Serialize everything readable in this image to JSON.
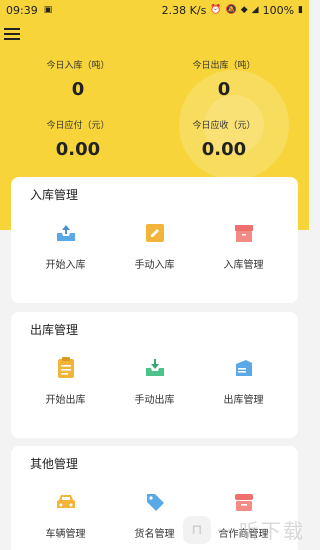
{
  "status_bar": {
    "time": "09:39",
    "speed": "2.38 K/s",
    "battery": "100%"
  },
  "header": {
    "stats": [
      {
        "label": "今日入库（吨）",
        "value": "0"
      },
      {
        "label": "今日出库（吨）",
        "value": "0"
      },
      {
        "label": "今日应付（元）",
        "value": "0.00"
      },
      {
        "label": "今日应收（元）",
        "value": "0.00"
      }
    ]
  },
  "sections": [
    {
      "title": "入库管理",
      "items": [
        {
          "label": "开始入库",
          "icon": "inbox-upload-icon",
          "color": "#5aa9e6"
        },
        {
          "label": "手动入库",
          "icon": "edit-icon",
          "color": "#f2b53a"
        },
        {
          "label": "入库管理",
          "icon": "box-manage-icon",
          "color": "#ef6f6c"
        }
      ]
    },
    {
      "title": "出库管理",
      "items": [
        {
          "label": "开始出库",
          "icon": "clipboard-icon",
          "color": "#f2b53a"
        },
        {
          "label": "手动出库",
          "icon": "download-tray-icon",
          "color": "#4cc38a"
        },
        {
          "label": "出库管理",
          "icon": "shipping-box-icon",
          "color": "#5aa9e6"
        }
      ]
    },
    {
      "title": "其他管理",
      "items": [
        {
          "label": "车辆管理",
          "icon": "car-icon",
          "color": "#f2b53a"
        },
        {
          "label": "货名管理",
          "icon": "tag-icon",
          "color": "#5aa9e6"
        },
        {
          "label": "合作商管理",
          "icon": "partner-box-icon",
          "color": "#ef6f6c"
        }
      ]
    }
  ],
  "watermark": {
    "text": "一听下载"
  }
}
